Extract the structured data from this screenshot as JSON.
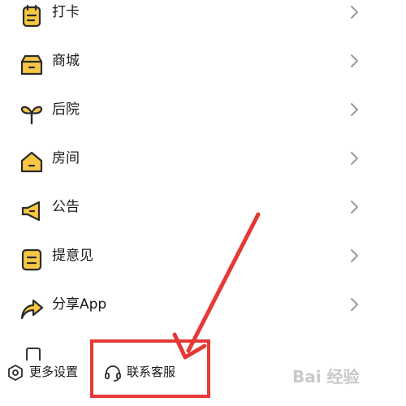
{
  "menu": {
    "items": [
      {
        "label": "打卡",
        "icon": "checkin-clipboard-icon"
      },
      {
        "label": "商城",
        "icon": "mall-shop-icon"
      },
      {
        "label": "后院",
        "icon": "sprout-icon"
      },
      {
        "label": "房间",
        "icon": "house-icon"
      },
      {
        "label": "公告",
        "icon": "megaphone-icon"
      },
      {
        "label": "提意见",
        "icon": "feedback-note-icon"
      },
      {
        "label": "分享App",
        "icon": "share-arrow-icon"
      }
    ]
  },
  "bottom": {
    "settings_label": "更多设置",
    "support_label": "联系客服"
  },
  "watermark": "Bai 经验",
  "colors": {
    "accent_yellow": "#F7C744",
    "icon_stroke": "#2b2b2b",
    "chevron": "#9a9a9a",
    "highlight_red": "#e53935"
  }
}
